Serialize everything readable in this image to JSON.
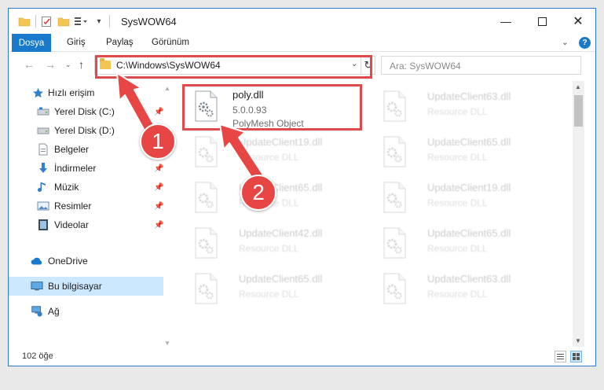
{
  "window": {
    "title": "SysWOW64"
  },
  "ribbon": {
    "tabs": [
      "Dosya",
      "Giriş",
      "Paylaş",
      "Görünüm"
    ]
  },
  "address": {
    "path": "C:\\Windows\\SysWOW64",
    "search_placeholder": "Ara: SysWOW64"
  },
  "sidebar": {
    "items": [
      {
        "label": "Hızlı erişim",
        "icon": "star-icon"
      },
      {
        "label": "Yerel Disk (C:)",
        "icon": "drive-icon",
        "pinned": true
      },
      {
        "label": "Yerel Disk (D:)",
        "icon": "drive-icon"
      },
      {
        "label": "Belgeler",
        "icon": "documents-icon"
      },
      {
        "label": "İndirmeler",
        "icon": "download-icon",
        "pinned": true
      },
      {
        "label": "Müzik",
        "icon": "music-icon",
        "pinned": true
      },
      {
        "label": "Resimler",
        "icon": "pictures-icon",
        "pinned": true
      },
      {
        "label": "Videolar",
        "icon": "videos-icon",
        "pinned": true
      },
      {
        "label": "OneDrive",
        "icon": "onedrive-icon"
      },
      {
        "label": "Bu bilgisayar",
        "icon": "computer-icon",
        "selected": true
      },
      {
        "label": "Ağ",
        "icon": "network-icon"
      }
    ]
  },
  "files": {
    "featured": {
      "name": "poly.dll",
      "version": "5.0.0.93",
      "type": "PolyMesh Object"
    },
    "ghosts": [
      {
        "name": "UpdateClient63.dll",
        "desc": "Resource DLL"
      },
      {
        "name": "UpdateClient19.dll",
        "desc": "Resource DLL"
      },
      {
        "name": "UpdateClient65.dll",
        "desc": "Resource DLL"
      },
      {
        "name": "UpdateClient65.dll",
        "desc": "Resource DLL"
      },
      {
        "name": "UpdateClient19.dll",
        "desc": "Resource DLL"
      },
      {
        "name": "UpdateClient42.dll",
        "desc": "Resource DLL"
      },
      {
        "name": "UpdateClient65.dll",
        "desc": "Resource DLL"
      },
      {
        "name": "UpdateClient65.dll",
        "desc": "Resource DLL"
      },
      {
        "name": "UpdateClient63.dll",
        "desc": "Resource DLL"
      }
    ]
  },
  "status": {
    "count": "102 öğe"
  },
  "annotations": {
    "step1": "1",
    "step2": "2"
  },
  "colors": {
    "accent": "#1979ca",
    "highlight": "#e04a4a",
    "badge": "#e84545"
  }
}
